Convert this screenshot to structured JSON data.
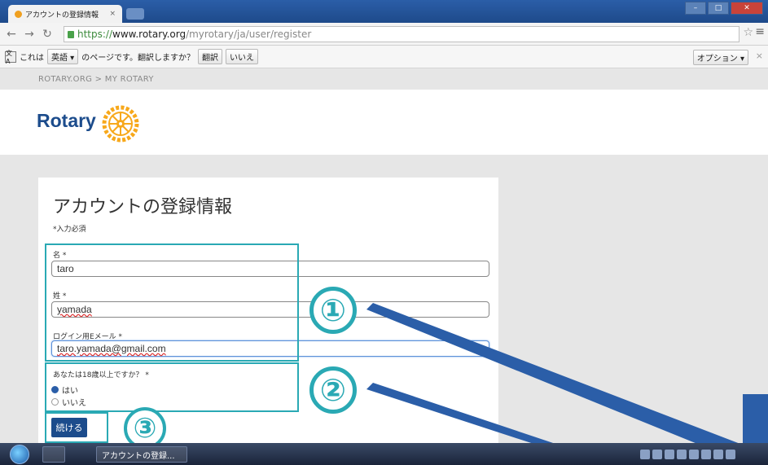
{
  "browser": {
    "tab_title": "アカウントの登録情報",
    "tab_close": "×",
    "url_scheme": "https://",
    "url_host": "www.rotary.org",
    "url_path": "/myrotary/ja/user/register"
  },
  "translate_bar": {
    "prefix": "これは",
    "language": "英語 ▾",
    "suffix": "のページです。翻訳しますか？",
    "translate_label": "翻訳",
    "no_label": "いいえ",
    "options_label": "オプション ▾",
    "close": "×"
  },
  "site": {
    "breadcrumb": "ROTARY.ORG > MY ROTARY",
    "logo_text": "Rotary",
    "brand_color": "#1c4c8c",
    "gold_color": "#f7a81b"
  },
  "form": {
    "title": "アカウントの登録情報",
    "required_note": "*入力必須",
    "first_name_label": "名 *",
    "first_name_value": "taro",
    "last_name_label": "姓 *",
    "last_name_value": "yamada",
    "email_label": "ログイン用Eメール *",
    "email_value": "taro.yamada@gmail.com",
    "age_question": "あなたは18歳以上ですか？ *",
    "age_yes": "はい",
    "age_no": "いいえ",
    "submit_label": "続ける"
  },
  "annotations": {
    "one": "①",
    "two": "②",
    "three": "③",
    "accent_color": "#2aa9b4"
  },
  "taskbar": {
    "item_label": "アカウントの登録..."
  }
}
